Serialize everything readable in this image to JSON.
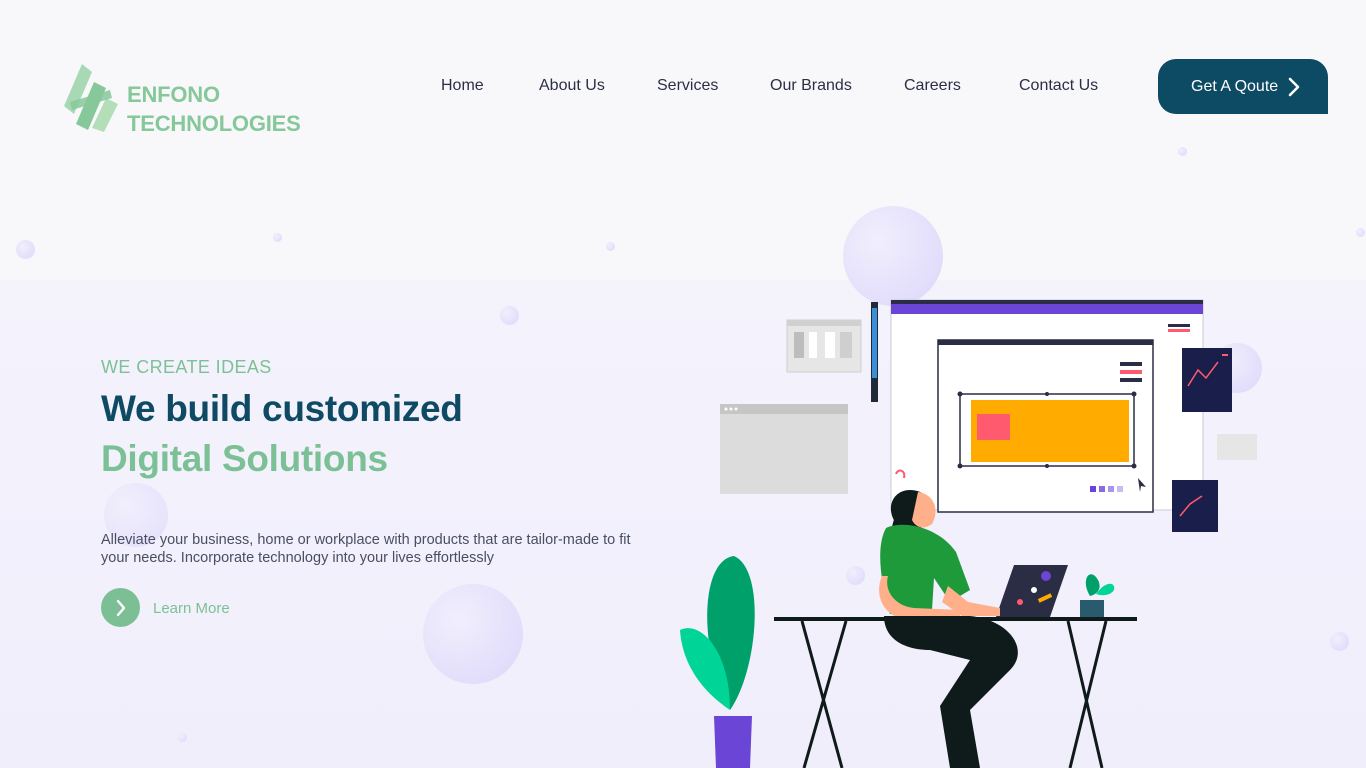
{
  "brand": {
    "name_line1": "ENFONO",
    "name_line2": "TECHNOLOGIES",
    "logo_color": "#86c89a"
  },
  "nav": {
    "items": [
      {
        "label": "Home"
      },
      {
        "label": "About Us"
      },
      {
        "label": "Services"
      },
      {
        "label": "Our Brands"
      },
      {
        "label": "Careers"
      },
      {
        "label": "Contact Us"
      }
    ],
    "cta_label": "Get A Qoute",
    "cta_icon": "chevron-right-icon"
  },
  "hero": {
    "eyebrow": "WE CREATE IDEAS",
    "headline_line1": "We build customized",
    "headline_line2": "Digital Solutions",
    "description": "Alleviate your business, home or workplace with products that are tailor-made to fit your needs. Incorporate technology into your lives effortlessly",
    "learn_more_label": "Learn More",
    "learn_more_icon": "chevron-right-icon"
  },
  "colors": {
    "primary_dark": "#0d4a64",
    "accent_green": "#7cc196",
    "text_dark": "#2b2f45",
    "illustration_orange": "#ffab00",
    "illustration_pink": "#ff5a6e",
    "illustration_purple": "#6a45d6"
  }
}
